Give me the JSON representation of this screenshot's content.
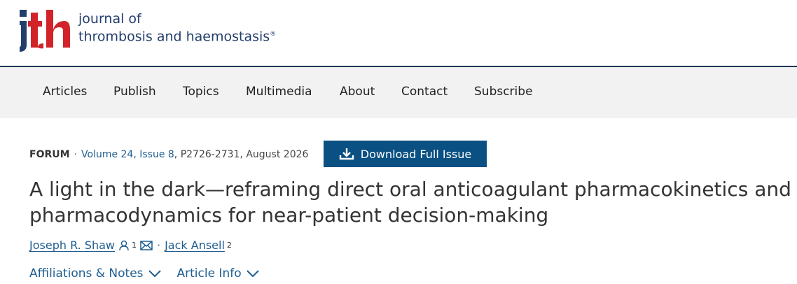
{
  "header": {
    "logo_text": "jth",
    "journal_line1": "journal of",
    "journal_line2": "thrombosis and haemostasis",
    "registered_mark": "®"
  },
  "nav": {
    "items": [
      "Articles",
      "Publish",
      "Topics",
      "Multimedia",
      "About",
      "Contact",
      "Subscribe"
    ]
  },
  "article_meta": {
    "type": "FORUM",
    "separator": "·",
    "volume_issue": "Volume 24, Issue 8",
    "pages_date": ", P2726-2731, August 2026"
  },
  "download_button": {
    "label": "Download Full Issue",
    "icon": "download-icon"
  },
  "article": {
    "title": "A light in the dark—reframing direct oral anticoagulant pharmacokinetics and pharmacodynamics for near-patient decision-making"
  },
  "authors": [
    {
      "name": "Joseph R. Shaw",
      "sup": "1",
      "icons": [
        "person-icon",
        "envelope-icon"
      ]
    },
    {
      "name": "Jack Ansell",
      "sup": "2"
    }
  ],
  "author_separator": "·",
  "links": {
    "affiliations": "Affiliations & Notes",
    "article_info": "Article Info"
  },
  "colors": {
    "brand_navy": "#233e6b",
    "logo_red": "#d2232a",
    "link_blue": "#1f5d8f",
    "button_blue": "#0b5082"
  }
}
